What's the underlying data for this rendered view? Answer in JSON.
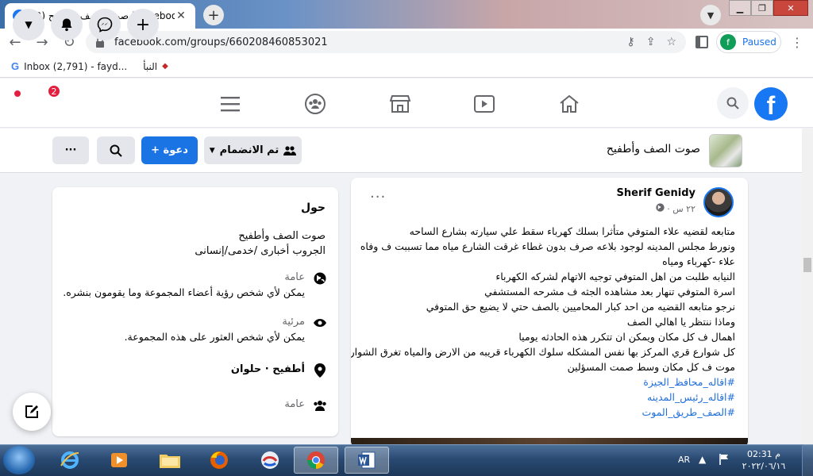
{
  "browser": {
    "tab_title": "(2) صوت الصف وأطفيح | Facebook",
    "tab_close": "✕",
    "new_tab": "+",
    "url": "facebook.com/groups/660208460853021",
    "profile_status": "Paused",
    "profile_initial": "f",
    "bookmarks": [
      {
        "label": "Inbox (2,791) - fayd..."
      },
      {
        "label": "النبأ"
      }
    ]
  },
  "fb_nav": {
    "notifications_count": "2",
    "logo_letter": "f"
  },
  "group": {
    "name": "صوت الصف وأطفيح",
    "join_button": "تم الانضمام",
    "invite_button": "+ دعوة",
    "more_button": "···"
  },
  "about": {
    "heading": "حول",
    "name": "صوت الصف وأطفيح",
    "tagline": "الجروب أخبارى /خدمى/إنسانى",
    "privacy_label": "عامة",
    "privacy_desc": "يمكن لأي شخص رؤية أعضاء المجموعة وما يقومون بنشره.",
    "visibility_label": "مرئية",
    "visibility_desc": "يمكن لأي شخص العثور على هذه المجموعة.",
    "location": "أطفيح · حلوان",
    "type_label": "عامة"
  },
  "post": {
    "author": "Sherif Genidy",
    "time": "٢٢ س · ",
    "more": "···",
    "lines": [
      "متابعه لقضيه علاء المتوفي متأثرا بسلك كهرباء سقط علي سيارته بشارع الساحه",
      "ونورط مجلس المدينه لوجود بلاعه صرف بدون غطاء غرقت الشارع مياه مما تسببت ف وفاه",
      "علاء -كهرباء ومياه",
      "النيابه طلبت من اهل المتوفي توجيه الاتهام لشركه الكهرباء",
      "اسرة المتوفي تنهار بعد مشاهده الجثه ف مشرحه المستشفي",
      "نرجو متابعه القضيه من احد كبار المحاميين بالصف حتي لا يضيع حق  المتوفي",
      "وماذا ننتظر يا اهالي الصف",
      "اهمال ف كل مكان ويمكن ان تتكرر هذه الحادثه يوميا",
      "كل شوارع قري المركز بها نفس المشكله سلوك الكهرباء قريبه من الارض والمياه تغرق الشوارع",
      "موت ف كل مكان وسط صمت المسؤلين"
    ],
    "hashtags": [
      "#اقاله_محافظ_الجيزة",
      "#اقاله_رئيس_المدينه",
      "#الصف_طريق_الموت"
    ]
  },
  "taskbar": {
    "lang": "AR",
    "time": "02:31 م",
    "date": "٢٠٢٢/٠٦/١٦"
  },
  "colors": {
    "fb_blue": "#1877f2",
    "button_blue": "#1b74e4",
    "badge_red": "#e41e3f",
    "hashtag": "#216fdb"
  },
  "icons": [
    "facebook-icon",
    "back-icon",
    "forward-icon",
    "reload-icon",
    "lock-icon",
    "key-icon",
    "share-icon",
    "star-icon",
    "side-panel-icon",
    "menu-icon",
    "search-icon",
    "groups-icon",
    "marketplace-icon",
    "watch-icon",
    "home-icon",
    "messenger-icon",
    "bell-icon",
    "plus-icon",
    "caret-icon",
    "globe-icon",
    "eye-icon",
    "location-icon",
    "people-icon",
    "edit-icon"
  ]
}
